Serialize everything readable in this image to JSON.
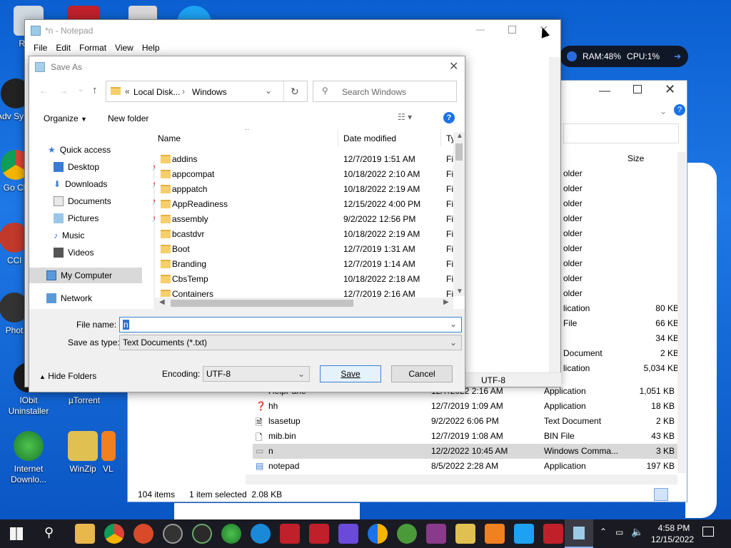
{
  "desktop": {
    "icons": [
      {
        "label": "Recy"
      },
      {
        "label": "Adv Syste"
      },
      {
        "label": "Go Ch"
      },
      {
        "label": "CCl"
      },
      {
        "label": "Phot"
      },
      {
        "label": "IObit Uninstaller"
      },
      {
        "label": "µTorrent"
      },
      {
        "label": "Internet Downlo..."
      },
      {
        "label": "WinZip"
      },
      {
        "label": "VL"
      }
    ]
  },
  "widget": {
    "ram": "RAM:48%",
    "cpu": "CPU:1%"
  },
  "explorer": {
    "size_header": "Size",
    "status_items": "104 items",
    "status_selected": "1 item selected  2.08 KB",
    "partial_rows": [
      {
        "type": "older",
        "size": ""
      },
      {
        "type": "older",
        "size": ""
      },
      {
        "type": "older",
        "size": ""
      },
      {
        "type": "older",
        "size": ""
      },
      {
        "type": "older",
        "size": ""
      },
      {
        "type": "older",
        "size": ""
      },
      {
        "type": "older",
        "size": ""
      },
      {
        "type": "older",
        "size": ""
      },
      {
        "type": "older",
        "size": ""
      },
      {
        "type": "lication",
        "size": "80 KB"
      },
      {
        "type": "File",
        "size": "66 KB"
      },
      {
        "type": "",
        "size": "34 KB"
      },
      {
        "type": "Document",
        "size": "2 KB"
      },
      {
        "type": "lication",
        "size": "5,034 KB"
      }
    ],
    "rows": [
      {
        "name": "HelpPane",
        "date": "12/7/2022 2:16 AM",
        "type": "Application",
        "size": "1,051 KB"
      },
      {
        "name": "hh",
        "date": "12/7/2019 1:09 AM",
        "type": "Application",
        "size": "18 KB"
      },
      {
        "name": "lsasetup",
        "date": "9/2/2022 6:06 PM",
        "type": "Text Document",
        "size": "2 KB"
      },
      {
        "name": "mib.bin",
        "date": "12/7/2019 1:08 AM",
        "type": "BIN File",
        "size": "43 KB"
      },
      {
        "name": "n",
        "date": "12/2/2022 10:45 AM",
        "type": "Windows Comma...",
        "size": "3 KB"
      },
      {
        "name": "notepad",
        "date": "8/5/2022 2:28 AM",
        "type": "Application",
        "size": "197 KB"
      }
    ]
  },
  "notepad": {
    "title": "*n - Notepad",
    "menu": [
      "File",
      "Edit",
      "Format",
      "View",
      "Help"
    ],
    "status_encoding": "UTF-8"
  },
  "dialog": {
    "title": "Save As",
    "address": [
      "Local Disk...",
      "Windows"
    ],
    "search_placeholder": "Search Windows",
    "organize": "Organize",
    "new_folder": "New folder",
    "nav": {
      "quick_access": "Quick access",
      "items": [
        "Desktop",
        "Downloads",
        "Documents",
        "Pictures",
        "Music",
        "Videos"
      ],
      "my_computer": "My Computer",
      "network": "Network"
    },
    "columns": {
      "name": "Name",
      "date": "Date modified",
      "type": "Ty"
    },
    "files": [
      {
        "name": "addins",
        "date": "12/7/2019 1:51 AM",
        "type": "Fi"
      },
      {
        "name": "appcompat",
        "date": "10/18/2022 2:10 AM",
        "type": "Fi"
      },
      {
        "name": "apppatch",
        "date": "10/18/2022 2:19 AM",
        "type": "Fi"
      },
      {
        "name": "AppReadiness",
        "date": "12/15/2022 4:00 PM",
        "type": "Fi"
      },
      {
        "name": "assembly",
        "date": "9/2/2022 12:56 PM",
        "type": "Fi"
      },
      {
        "name": "bcastdvr",
        "date": "10/18/2022 2:19 AM",
        "type": "Fi"
      },
      {
        "name": "Boot",
        "date": "12/7/2019 1:31 AM",
        "type": "Fi"
      },
      {
        "name": "Branding",
        "date": "12/7/2019 1:14 AM",
        "type": "Fi"
      },
      {
        "name": "CbsTemp",
        "date": "10/18/2022 2:18 AM",
        "type": "Fi"
      },
      {
        "name": "Containers",
        "date": "12/7/2019 2:16 AM",
        "type": "Fi"
      }
    ],
    "file_name_label": "File name:",
    "file_name_value": "n",
    "save_type_label": "Save as type:",
    "save_type_value": "Text Documents (*.txt)",
    "hide_folders": "Hide Folders",
    "encoding_label": "Encoding:",
    "encoding_value": "UTF-8",
    "save": "Save",
    "cancel": "Cancel"
  },
  "taskbar": {
    "time": "4:58 PM",
    "date": "12/15/2022"
  }
}
